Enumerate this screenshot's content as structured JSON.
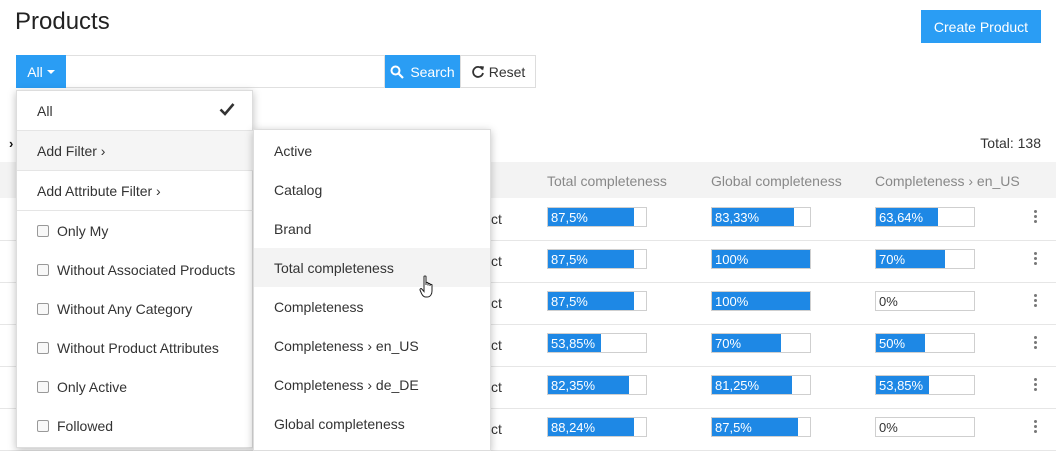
{
  "page": {
    "title": "Products",
    "create_label": "Create Product"
  },
  "search": {
    "filter_label": "All",
    "value": "",
    "placeholder": "",
    "search_label": "Search",
    "reset_label": "Reset"
  },
  "total_label": "Total: 138",
  "columns": [
    "Total completeness",
    "Global completeness",
    "Completeness › en_US"
  ],
  "rows": [
    {
      "name": "ct",
      "total": {
        "text": "87,5%",
        "pct": 87.5
      },
      "global": {
        "text": "83,33%",
        "pct": 83.33
      },
      "en_us": {
        "text": "63,64%",
        "pct": 63.64
      }
    },
    {
      "name": "ct",
      "total": {
        "text": "87,5%",
        "pct": 87.5
      },
      "global": {
        "text": "100%",
        "pct": 100
      },
      "en_us": {
        "text": "70%",
        "pct": 70
      }
    },
    {
      "name": "ct",
      "total": {
        "text": "87,5%",
        "pct": 87.5
      },
      "global": {
        "text": "100%",
        "pct": 100
      },
      "en_us": {
        "text": "0%",
        "pct": 0
      }
    },
    {
      "name": "ct",
      "total": {
        "text": "53,85%",
        "pct": 53.85
      },
      "global": {
        "text": "70%",
        "pct": 70
      },
      "en_us": {
        "text": "50%",
        "pct": 50
      }
    },
    {
      "name": "ct",
      "total": {
        "text": "82,35%",
        "pct": 82.35
      },
      "global": {
        "text": "81,25%",
        "pct": 81.25
      },
      "en_us": {
        "text": "53,85%",
        "pct": 53.85
      }
    },
    {
      "name": "ct",
      "total": {
        "text": "88,24%",
        "pct": 88.24
      },
      "global": {
        "text": "87,5%",
        "pct": 87.5
      },
      "en_us": {
        "text": "0%",
        "pct": 0
      }
    }
  ],
  "filter_menu": {
    "all_label": "All",
    "add_filter_label": "Add Filter ›",
    "add_attribute_filter_label": "Add Attribute Filter ›",
    "checkboxes": [
      "Only My",
      "Without Associated Products",
      "Without Any Category",
      "Without Product Attributes",
      "Only Active",
      "Followed"
    ]
  },
  "submenu": [
    "Active",
    "Catalog",
    "Brand",
    "Total completeness",
    "Completeness",
    "Completeness › en_US",
    "Completeness › de_DE",
    "Global completeness"
  ],
  "colors": {
    "accent": "#2a9df4",
    "bar_fill": "#1e88e5"
  },
  "icons": {
    "search": "search-icon",
    "reset": "reset-icon",
    "check": "check-icon",
    "cursor": "hand-cursor-icon",
    "menu": "kebab-icon"
  }
}
